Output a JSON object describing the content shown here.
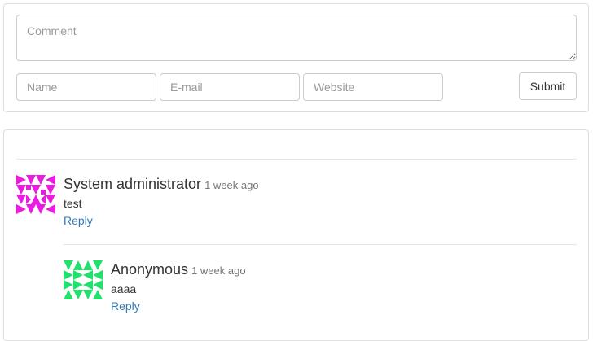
{
  "form": {
    "comment_placeholder": "Comment",
    "name_placeholder": "Name",
    "email_placeholder": "E-mail",
    "website_placeholder": "Website",
    "submit_label": "Submit"
  },
  "comments": [
    {
      "author": "System administrator",
      "time": "1 week ago",
      "text": "test",
      "reply_label": "Reply",
      "avatar_icon": "identicon-magenta",
      "avatar_color": "#e91ce0"
    },
    {
      "author": "Anonymous",
      "time": "1 week ago",
      "text": "aaaa",
      "reply_label": "Reply",
      "avatar_icon": "identicon-green",
      "avatar_color": "#22e06c"
    }
  ],
  "colors": {
    "link": "#337ab7",
    "border": "#dddddd",
    "muted": "#777777"
  }
}
